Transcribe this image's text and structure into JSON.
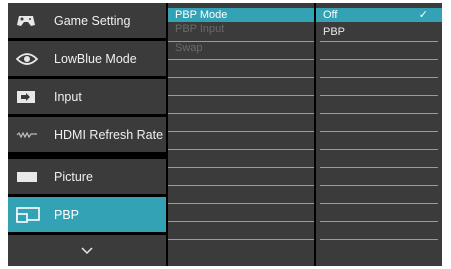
{
  "sidebar": {
    "items": [
      {
        "label": "Game Setting",
        "icon": "gamepad-icon"
      },
      {
        "label": "LowBlue Mode",
        "icon": "eye-icon"
      },
      {
        "label": "Input",
        "icon": "input-icon"
      },
      {
        "label": "HDMI Refresh Rate",
        "icon": "refresh-rate-icon"
      },
      {
        "label": "Picture",
        "icon": "picture-icon"
      },
      {
        "label": "PBP",
        "icon": "pbp-icon"
      }
    ],
    "more_icon": "chevron-down-icon"
  },
  "submenu": {
    "items": [
      {
        "label": "PBP Mode"
      },
      {
        "label": "PBP Input"
      },
      {
        "label": "Swap"
      }
    ]
  },
  "options": {
    "items": [
      {
        "label": "Off"
      },
      {
        "label": "PBP"
      }
    ],
    "check": "✓"
  },
  "colors": {
    "accent": "#33a2b5",
    "panel": "#3b3b3b",
    "background": "#000000"
  }
}
